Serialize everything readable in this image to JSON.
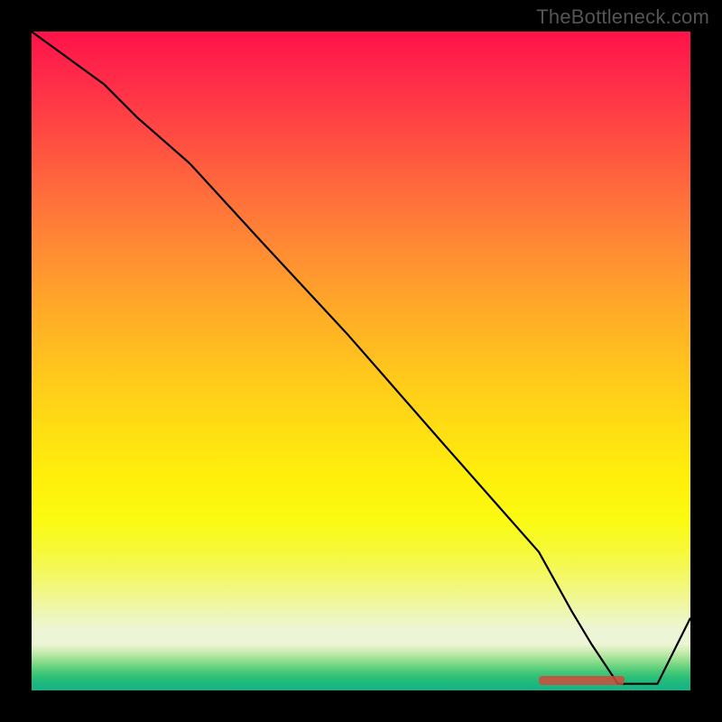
{
  "watermark": "TheBottleneck.com",
  "colors": {
    "line": "#000000",
    "marker": "#d24a3a",
    "frame": "#000000"
  },
  "chart_data": {
    "type": "line",
    "title": "",
    "xlabel": "",
    "ylabel": "",
    "xlim": [
      0,
      100
    ],
    "ylim": [
      0,
      100
    ],
    "grid": false,
    "series": [
      {
        "name": "curve",
        "x": [
          0,
          11,
          16,
          24,
          35,
          48,
          62,
          77,
          82,
          85,
          89,
          95,
          100
        ],
        "y": [
          100,
          92,
          87,
          80,
          68,
          54,
          38,
          21,
          12,
          7,
          1,
          1,
          11
        ]
      }
    ],
    "annotations": [
      {
        "type": "marker-bar",
        "name": "plateau-marker",
        "x_start": 77,
        "x_end": 90,
        "y": 1.5
      }
    ],
    "background_gradient_stops": [
      {
        "pct": 0,
        "color": "#ff1249"
      },
      {
        "pct": 15,
        "color": "#ff4843"
      },
      {
        "pct": 33,
        "color": "#ff8b33"
      },
      {
        "pct": 51,
        "color": "#ffc51d"
      },
      {
        "pct": 68,
        "color": "#fff00b"
      },
      {
        "pct": 86,
        "color": "#f0f79b"
      },
      {
        "pct": 94,
        "color": "#cfeeb5"
      },
      {
        "pct": 100,
        "color": "#15b487"
      }
    ]
  }
}
